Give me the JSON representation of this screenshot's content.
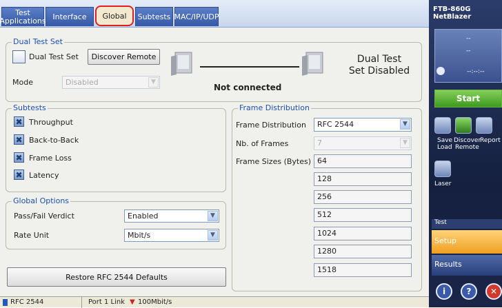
{
  "tabs": [
    {
      "label_line1": "Test",
      "label_line2": "Applications"
    },
    {
      "label": "Interface"
    },
    {
      "label": "Global"
    },
    {
      "label": "Subtests"
    },
    {
      "label": "MAC/IP/UDP"
    }
  ],
  "dual_test": {
    "title": "Dual Test Set",
    "checkbox_label": "Dual Test Set",
    "discover_button": "Discover Remote",
    "mode_label": "Mode",
    "mode_value": "Disabled",
    "connection_status": "Not connected",
    "status_line1": "Dual Test",
    "status_line2": "Set Disabled"
  },
  "subtests": {
    "title": "Subtests",
    "items": [
      {
        "label": "Throughput",
        "checked": true
      },
      {
        "label": "Back-to-Back",
        "checked": true
      },
      {
        "label": "Frame Loss",
        "checked": true
      },
      {
        "label": "Latency",
        "checked": true
      }
    ]
  },
  "global_options": {
    "title": "Global Options",
    "pass_fail_label": "Pass/Fail Verdict",
    "pass_fail_value": "Enabled",
    "rate_unit_label": "Rate Unit",
    "rate_unit_value": "Mbit/s"
  },
  "restore_button": "Restore RFC 2544 Defaults",
  "frame_distribution": {
    "title": "Frame Distribution",
    "dist_label": "Frame Distribution",
    "dist_value": "RFC 2544",
    "nb_frames_label": "Nb. of Frames",
    "nb_frames_value": "7",
    "sizes_label": "Frame Sizes (Bytes)",
    "sizes": [
      "64",
      "128",
      "256",
      "512",
      "1024",
      "1280",
      "1518"
    ]
  },
  "statusbar": {
    "test": "RFC 2544",
    "port": "Port 1 Link",
    "speed": "100Mbit/s"
  },
  "side": {
    "device_line1": "FTB-860G",
    "device_line2": "NetBlazer",
    "panel_line1": "--",
    "panel_line2": "--",
    "timer": "--:--:--",
    "start": "Start",
    "save_load_1": "Save",
    "save_load_2": "Load",
    "discover_1": "Discover",
    "discover_2": "Remote",
    "report": "Report",
    "laser": "Laser",
    "test_label": "Test",
    "setup": "Setup",
    "results": "Results"
  },
  "colors": {
    "accent_blue": "#1c4fb0",
    "tab_blue": "#3658a6",
    "active_tab_border": "#e02020",
    "start_green": "#3d9a1e",
    "setup_orange": "#f0a020"
  }
}
